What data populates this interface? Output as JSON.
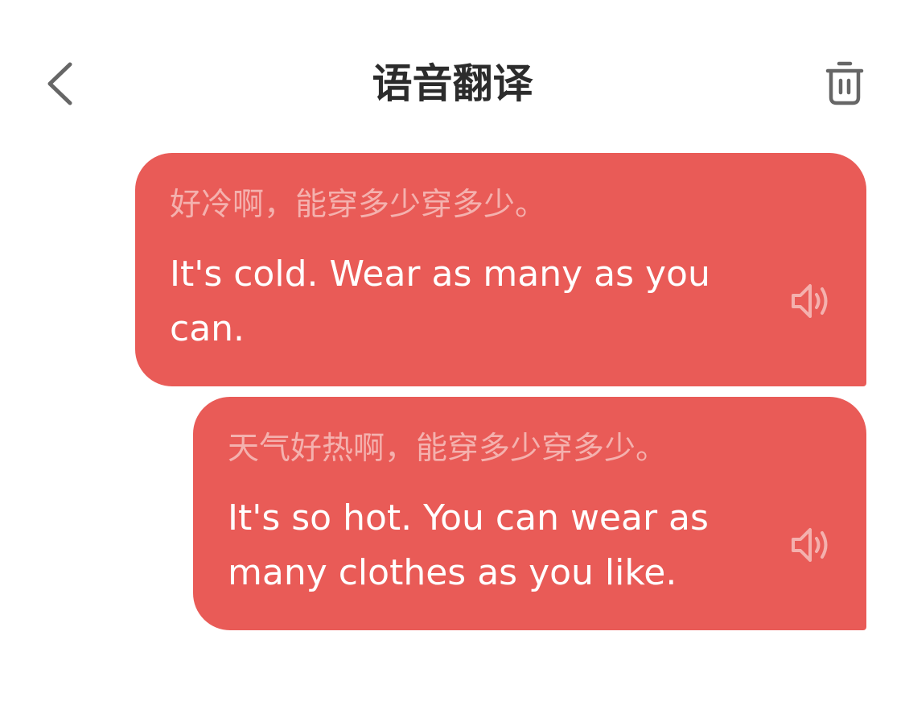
{
  "header": {
    "title": "语音翻译",
    "back_icon": "chevron-left-icon",
    "trash_icon": "trash-icon"
  },
  "messages": [
    {
      "source": "好冷啊，能穿多少穿多少。",
      "translation": "It's cold. Wear as many as you can.",
      "speaker_icon": "speaker-icon"
    },
    {
      "source": "天气好热啊，能穿多少穿多少。",
      "translation": "It's so hot. You can wear as many clothes as you like.",
      "speaker_icon": "speaker-icon"
    }
  ],
  "colors": {
    "bubble": "#e95b57",
    "source_text": "#f4b1ae",
    "translation_text": "#ffffff",
    "title_text": "#2c2c2c",
    "icon": "#666666"
  }
}
